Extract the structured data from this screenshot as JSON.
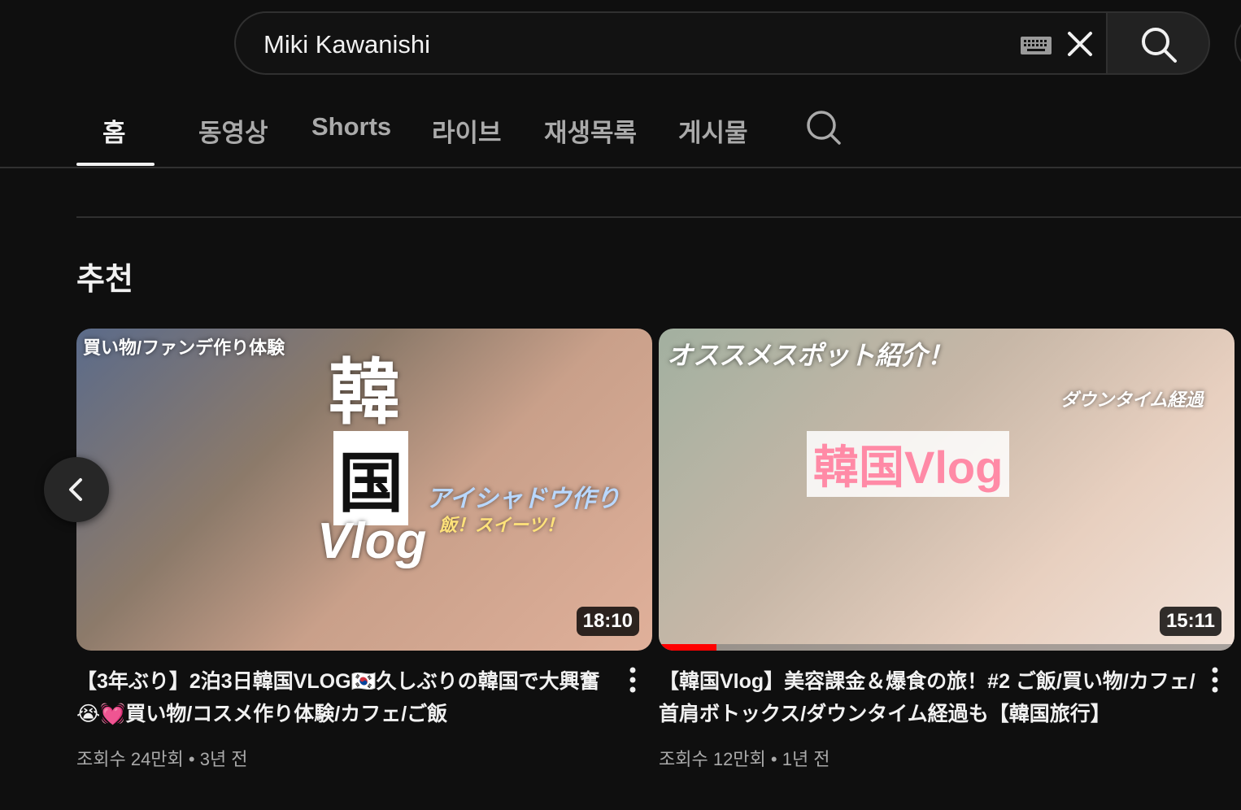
{
  "search": {
    "value": "Miki Kawanishi"
  },
  "tabs": [
    {
      "label": "홈",
      "active": true
    },
    {
      "label": "동영상"
    },
    {
      "label": "Shorts"
    },
    {
      "label": "라이브"
    },
    {
      "label": "재생목록"
    },
    {
      "label": "게시물"
    }
  ],
  "section": {
    "title": "추천"
  },
  "videos": [
    {
      "title": "【3年ぶり】2泊3日韓国VLOG🇰🇷久しぶりの韓国で大興奮😭💓買い物/コスメ作り体験/カフェ/ご飯",
      "duration": "18:10",
      "meta": "조회수 24만회 • 3년 전",
      "thumb_texts": [
        "買い物/ファンデ作り体験",
        "韓",
        "国",
        "Vlog",
        "アイシャドウ作り",
        "飯！スイーツ！"
      ]
    },
    {
      "title": "【韓国Vlog】美容課金＆爆食の旅！#2 ご飯/買い物/カフェ/首肩ボトックス/ダウンタイム経過も【韓国旅行】",
      "duration": "15:11",
      "meta": "조회수 12만회 • 1년 전",
      "progress": 0.1,
      "thumb_texts": [
        "オススメスポット紹介！",
        "韓国Vlog",
        "ダウンタイム経過"
      ]
    }
  ],
  "colors": {
    "background": "#0f0f0f",
    "progress": "#ff0000"
  }
}
